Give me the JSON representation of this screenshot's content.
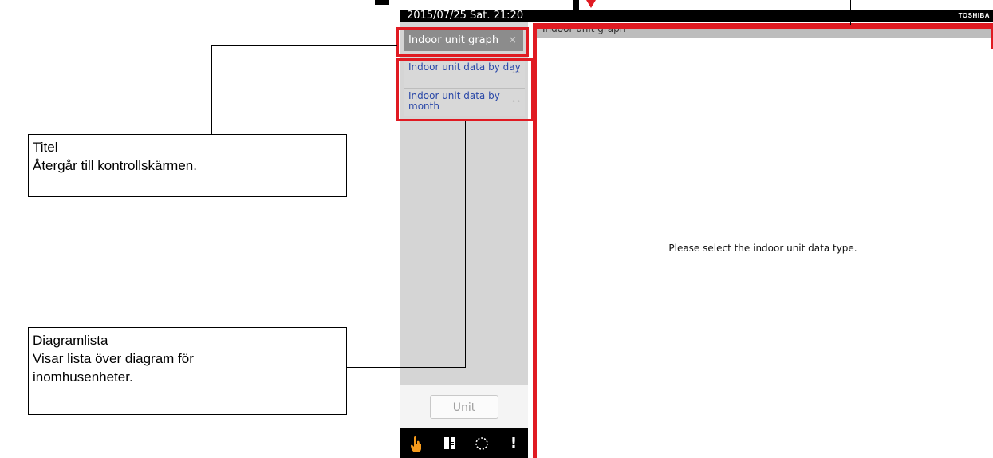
{
  "status_bar": {
    "datetime": "2015/07/25 Sat. 21:20",
    "brand": "TOSHIBA"
  },
  "sidebar": {
    "title_tab": {
      "label": "Indoor unit graph",
      "close_glyph": "×"
    },
    "graph_list": [
      {
        "label": "Indoor unit data by day"
      },
      {
        "label": "Indoor unit data by month"
      }
    ],
    "unit_button": "Unit",
    "bottom_icons": [
      "hand-pointer-icon",
      "book-icon",
      "dotted-circle-icon",
      "exclamation-icon"
    ]
  },
  "main": {
    "header": "Indoor unit graph",
    "message": "Please select the indoor unit data type."
  },
  "callouts": {
    "title": {
      "heading": "Titel",
      "text": "Återgår till kontrollskärmen."
    },
    "list": {
      "heading": "Diagramlista",
      "text": "Visar lista över diagram för inomhusenheter."
    }
  },
  "colors": {
    "highlight": "#e01a22",
    "link": "#2a48a8"
  }
}
